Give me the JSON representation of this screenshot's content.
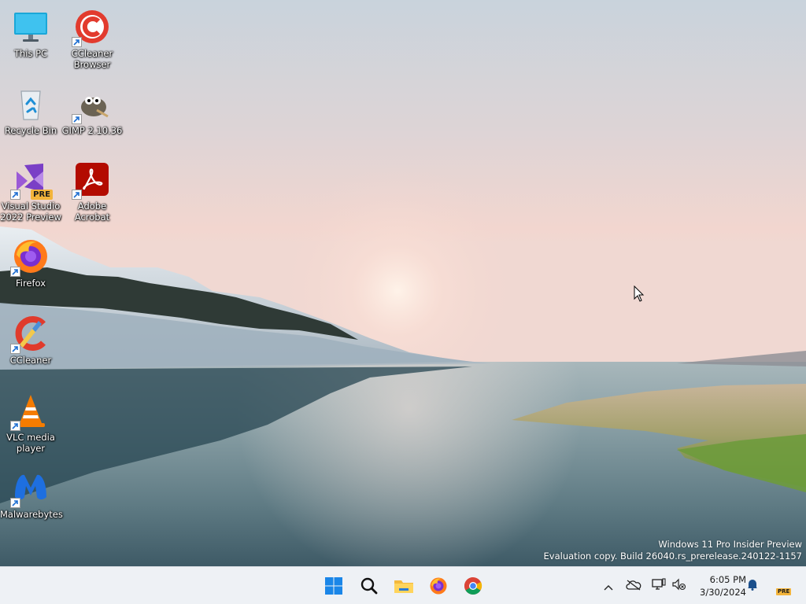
{
  "desktop": {
    "icons": [
      {
        "label": "This PC",
        "icon": "monitor-icon"
      },
      {
        "label": "CCleaner\nBrowser",
        "icon": "ccleaner-browser-icon"
      },
      {
        "label": "Recycle Bin",
        "icon": "recycle-bin-icon"
      },
      {
        "label": "GIMP 2.10.36",
        "icon": "gimp-icon"
      },
      {
        "label": "Visual Studio\n2022 Preview",
        "icon": "visual-studio-icon",
        "badge": "PRE"
      },
      {
        "label": "Adobe\nAcrobat",
        "icon": "adobe-acrobat-icon"
      },
      {
        "label": "Firefox",
        "icon": "firefox-icon"
      },
      {
        "label": "CCleaner",
        "icon": "ccleaner-icon"
      },
      {
        "label": "VLC media\nplayer",
        "icon": "vlc-icon"
      },
      {
        "label": "Malwarebytes",
        "icon": "malwarebytes-icon"
      }
    ],
    "watermark": {
      "line1": "Windows 11 Pro Insider Preview",
      "line2": "Evaluation copy. Build 26040.rs_prerelease.240122-1157"
    }
  },
  "taskbar": {
    "apps": [
      {
        "name": "Start",
        "icon": "windows-start-icon"
      },
      {
        "name": "Search",
        "icon": "search-icon"
      },
      {
        "name": "File Explorer",
        "icon": "folder-icon"
      },
      {
        "name": "Firefox",
        "icon": "firefox-icon"
      },
      {
        "name": "Chrome",
        "icon": "chrome-icon"
      }
    ],
    "tray": {
      "icons": [
        "chevron-up-icon",
        "onedrive-offline-icon",
        "network-icon",
        "volume-muted-icon"
      ],
      "time": "6:05 PM",
      "date": "3/30/2024",
      "notification_icon": "bell-icon",
      "badge": "PRE"
    }
  },
  "colors": {
    "taskbar_bg": "#eef1f5",
    "accent_blue": "#0a6cd8"
  }
}
